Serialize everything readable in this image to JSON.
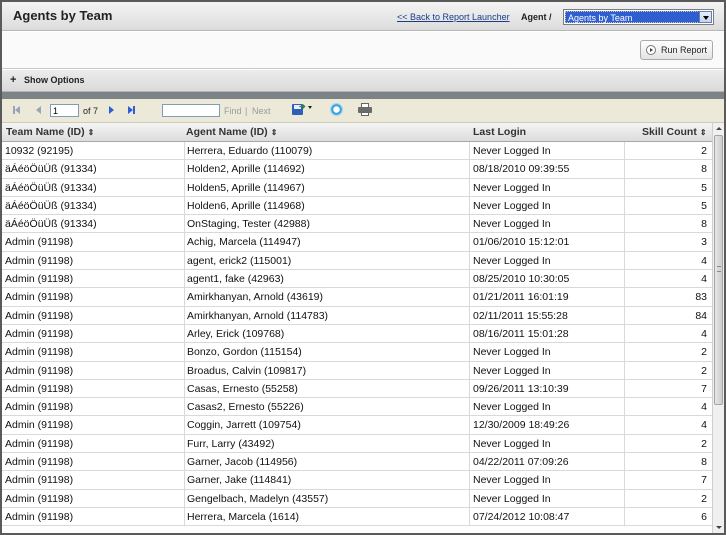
{
  "header": {
    "title": "Agents by Team",
    "back_link": "<< Back to Report Launcher",
    "agent_label": "Agent /",
    "report_select": "Agents by Team"
  },
  "run_button": "Run Report",
  "options": {
    "label": "Show Options",
    "icon": "plus-icon"
  },
  "toolbar": {
    "page_value": "1",
    "page_of": "of 7",
    "find_value": "",
    "find_label": "Find",
    "separator": "|",
    "next_label": "Next",
    "icons": [
      "first-page-icon",
      "prev-page-icon",
      "next-page-icon",
      "last-page-icon",
      "export-icon",
      "refresh-icon",
      "print-icon"
    ]
  },
  "table": {
    "columns": [
      "Team Name (ID)",
      "Agent Name (ID)",
      "Last Login",
      "Skill Count"
    ],
    "sort_glyph": "⇕",
    "rows": [
      [
        "10932 (92195)",
        "Herrera, Eduardo (110079)",
        "Never Logged In",
        "2"
      ],
      [
        "äÁéöÖüÜß (91334)",
        "Holden2, Aprille (114692)",
        "08/18/2010 09:39:55",
        "8"
      ],
      [
        "äÁéöÖüÜß (91334)",
        "Holden5, Aprille (114967)",
        "Never Logged In",
        "5"
      ],
      [
        "äÁéöÖüÜß (91334)",
        "Holden6, Aprille (114968)",
        "Never Logged In",
        "5"
      ],
      [
        "äÁéöÖüÜß (91334)",
        "OnStaging, Tester (42988)",
        "Never Logged In",
        "8"
      ],
      [
        "Admin (91198)",
        "Achig, Marcela (114947)",
        "01/06/2010 15:12:01",
        "3"
      ],
      [
        "Admin (91198)",
        "agent, erick2 (115001)",
        "Never Logged In",
        "4"
      ],
      [
        "Admin (91198)",
        "agent1, fake (42963)",
        "08/25/2010 10:30:05",
        "4"
      ],
      [
        "Admin (91198)",
        "Amirkhanyan, Arnold (43619)",
        "01/21/2011 16:01:19",
        "83"
      ],
      [
        "Admin (91198)",
        "Amirkhanyan, Arnold (114783)",
        "02/11/2011 15:55:28",
        "84"
      ],
      [
        "Admin (91198)",
        "Arley, Erick (109768)",
        "08/16/2011 15:01:28",
        "4"
      ],
      [
        "Admin (91198)",
        "Bonzo, Gordon (115154)",
        "Never Logged In",
        "2"
      ],
      [
        "Admin (91198)",
        "Broadus, Calvin (109817)",
        "Never Logged In",
        "2"
      ],
      [
        "Admin (91198)",
        "Casas, Ernesto (55258)",
        "09/26/2011 13:10:39",
        "7"
      ],
      [
        "Admin (91198)",
        "Casas2, Ernesto (55226)",
        "Never Logged In",
        "4"
      ],
      [
        "Admin (91198)",
        "Coggin, Jarrett (109754)",
        "12/30/2009 18:49:26",
        "4"
      ],
      [
        "Admin (91198)",
        "Furr, Larry (43492)",
        "Never Logged In",
        "2"
      ],
      [
        "Admin (91198)",
        "Garner, Jacob (114956)",
        "04/22/2011 07:09:26",
        "8"
      ],
      [
        "Admin (91198)",
        "Garner, Jake (114841)",
        "Never Logged In",
        "7"
      ],
      [
        "Admin (91198)",
        "Gengelbach, Madelyn (43557)",
        "Never Logged In",
        "2"
      ],
      [
        "Admin (91198)",
        "Herrera, Marcela (1614)",
        "07/24/2012 10:08:47",
        "6"
      ]
    ]
  }
}
